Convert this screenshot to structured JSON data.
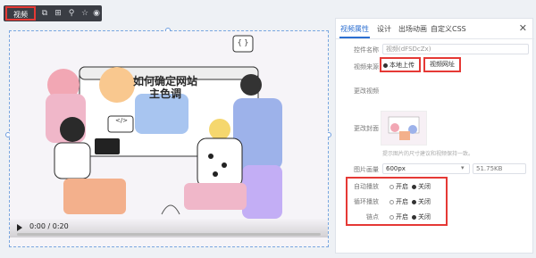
{
  "toolbar": {
    "label": "视频",
    "icons": [
      "copy-icon",
      "grid-icon",
      "link-icon",
      "star-icon",
      "eye-icon"
    ]
  },
  "video": {
    "overlay_title": "如何确定网站\n主色调",
    "brace_text": "{ }",
    "code_text": "</>",
    "time": "0:00 / 0:20",
    "progress": 0.0
  },
  "panel": {
    "tabs": [
      "视频属性",
      "设计",
      "出场动画",
      "自定义CSS"
    ],
    "active_tab": 0,
    "close": "✕",
    "control_name_label": "控件名称",
    "control_name_value": "视频(dFSDcZx)",
    "source_label": "视频来源",
    "source_local": "本地上传",
    "source_url": "视频网址",
    "change_video_label": "更改视频",
    "change_cover_label": "更改封面",
    "cover_hint": "提示图片的尺寸建议和视频保持一致。",
    "size_label": "图片画量",
    "size_value": "600px",
    "size_meta": "51.75KB",
    "autoplay_label": "自动播放",
    "loop_label": "循环播放",
    "link_label": "链点",
    "on": "开启",
    "off": "关闭"
  },
  "colors": {
    "accent": "#2c6fd1",
    "highlight_red": "#e53935",
    "toolbar_bg": "#3a3d44"
  }
}
